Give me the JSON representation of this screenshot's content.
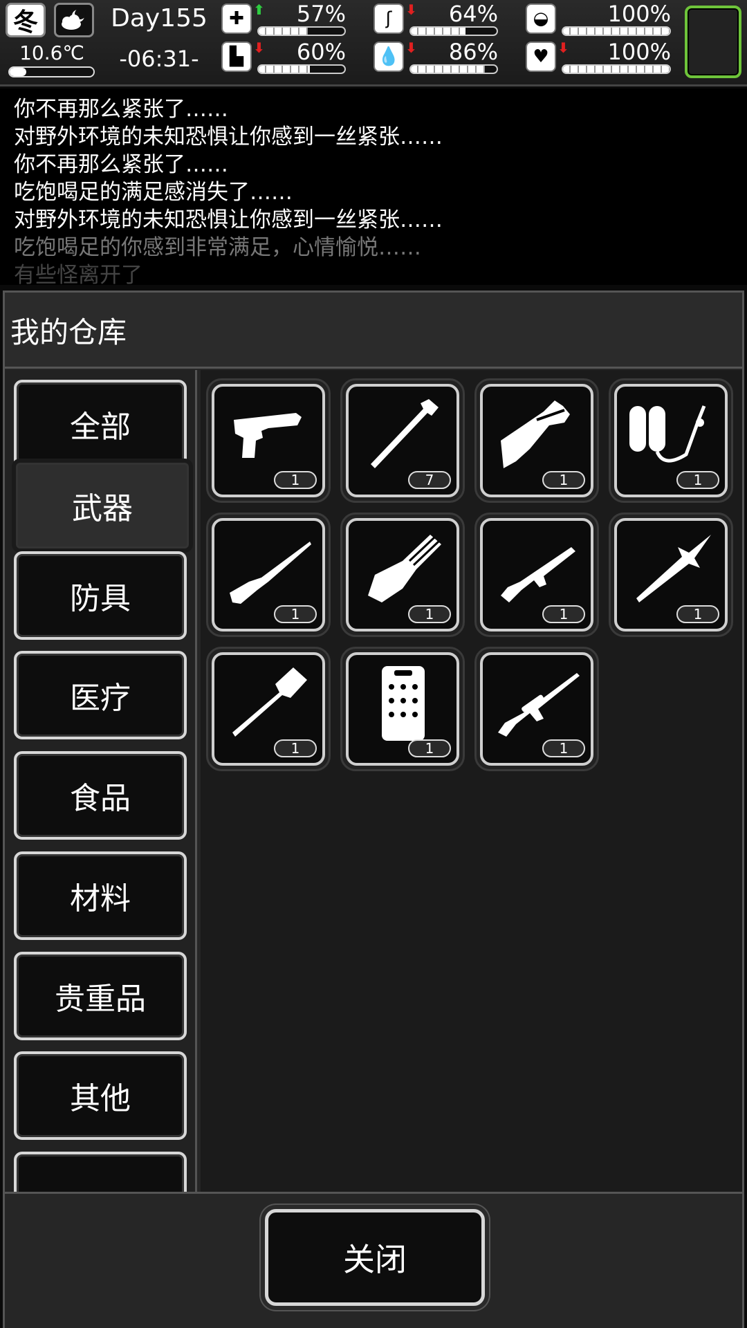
{
  "hud": {
    "season": "冬",
    "weather_icon": "night-cloud-icon",
    "temperature": "10.6℃",
    "temperature_level": 0.2,
    "day": "Day155",
    "time": "-06:31-",
    "stats": [
      {
        "icon": "medkit-icon",
        "arrow": "up",
        "arrow_color": "#2ecc40",
        "percent": "57%",
        "value": 57
      },
      {
        "icon": "stomach-icon",
        "arrow": "down",
        "arrow_color": "#e02020",
        "percent": "64%",
        "value": 64
      },
      {
        "icon": "mood-icon",
        "arrow": "",
        "arrow_color": "",
        "percent": "100%",
        "value": 100
      },
      {
        "icon": "boot-icon",
        "arrow": "down",
        "arrow_color": "#e02020",
        "percent": "60%",
        "value": 60
      },
      {
        "icon": "water-drop-icon",
        "arrow": "down",
        "arrow_color": "#e02020",
        "percent": "86%",
        "value": 86
      },
      {
        "icon": "heart-icon",
        "arrow": "down",
        "arrow_color": "#e02020",
        "percent": "100%",
        "value": 100
      }
    ],
    "avatar_border_color": "#6ec43a"
  },
  "messages": [
    "你不再那么紧张了……",
    "对野外环境的未知恐惧让你感到一丝紧张……",
    "你不再那么紧张了……",
    "吃饱喝足的满足感消失了……",
    "对野外环境的未知恐惧让你感到一丝紧张……",
    "吃饱喝足的你感到非常满足，心情愉悦……",
    "有些怪离开了"
  ],
  "warehouse": {
    "title": "我的仓库",
    "categories": [
      "全部",
      "武器",
      "防具",
      "医疗",
      "食品",
      "材料",
      "贵重品",
      "其他"
    ],
    "active_category": "武器",
    "items": [
      {
        "icon": "pistol-icon",
        "qty": "1"
      },
      {
        "icon": "pipe-icon",
        "qty": "7"
      },
      {
        "icon": "machete-icon",
        "qty": "1"
      },
      {
        "icon": "flamethrower-icon",
        "qty": "1"
      },
      {
        "icon": "rifle-icon",
        "qty": "1"
      },
      {
        "icon": "minigun-icon",
        "qty": "1"
      },
      {
        "icon": "assault-rifle-icon",
        "qty": "1"
      },
      {
        "icon": "spear-icon",
        "qty": "1"
      },
      {
        "icon": "shovel-icon",
        "qty": "1"
      },
      {
        "icon": "riot-shield-icon",
        "qty": "1"
      },
      {
        "icon": "sniper-rifle-icon",
        "qty": "1"
      }
    ],
    "close_label": "关闭"
  }
}
